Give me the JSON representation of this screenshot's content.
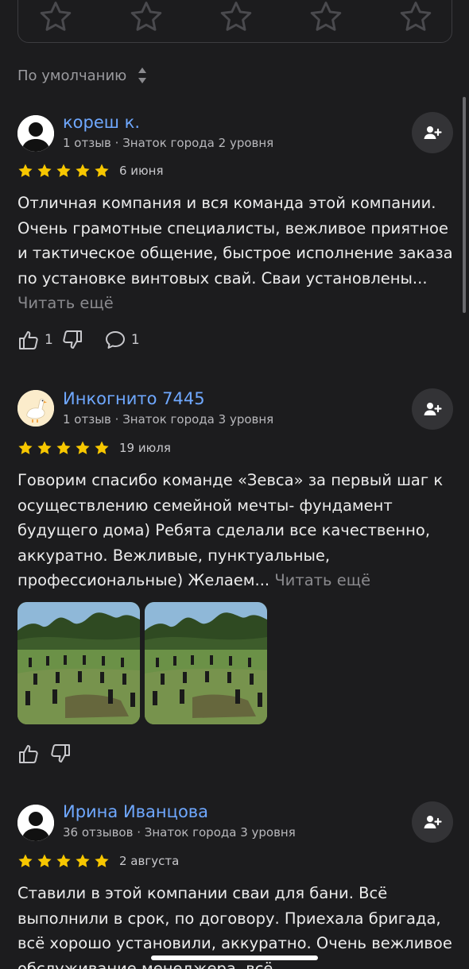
{
  "colors": {
    "background": "#1c1c1e",
    "author_link": "#6fa8ff",
    "star": "#f7c700",
    "muted": "#8a8a8e"
  },
  "rating_box": {
    "empty_stars": 5,
    "icon": "star-outline-icon"
  },
  "sort": {
    "label": "По умолчанию",
    "icon": "sort-arrows-icon"
  },
  "reviews": [
    {
      "author": "кореш к.",
      "meta": "1 отзыв · Знаток города 2 уровня",
      "avatar": "default-avatar-icon",
      "rating": 5,
      "date": "6 июня",
      "text": "Отличная компания и вся команда этой компании. Очень грамотные специалисты, вежливое приятное и тактическое общение, быстрое исполнение заказа по установке винтовых свай. Сваи установлены...",
      "read_more": "Читать ещё",
      "likes": "1",
      "comments": "1"
    },
    {
      "author": "Инкогнито 7445",
      "meta": "1 отзыв · Знаток города 3 уровня",
      "avatar": "goose-avatar-icon",
      "rating": 5,
      "date": "19 июля",
      "text": "Говорим спасибо команде «Зевса» за первый шаг к осуществлению семейной мечты- фундамент будущего дома) Ребята сделали все качественно, аккуратно. Вежливые, пунктуальные, профессиональные) Желаем...",
      "read_more": "Читать ещё",
      "photo_count": 2
    },
    {
      "author": "Ирина Иванцова",
      "meta": "36 отзывов · Знаток города 3 уровня",
      "avatar": "default-avatar-icon",
      "rating": 5,
      "date": "2 августа",
      "text": "Ставили в этой компании сваи для бани. Всё выполнили в срок, по договору. Приехала бригада, всё хорошо установили, аккуратно. Очень вежливое обслуживание менеджера, всё"
    }
  ]
}
